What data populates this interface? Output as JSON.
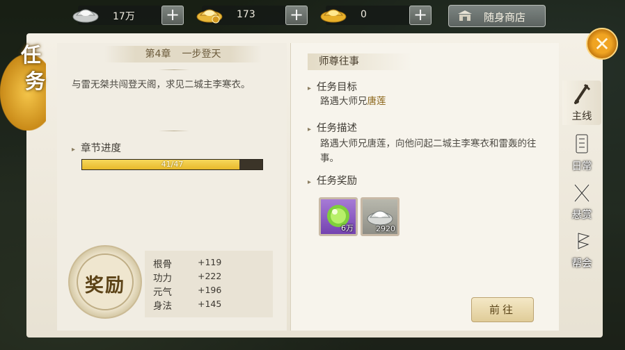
{
  "currency": [
    {
      "name": "silver",
      "value": "17万"
    },
    {
      "name": "gold-ingot",
      "value": "173"
    },
    {
      "name": "bound-gold",
      "value": "0"
    }
  ],
  "shop_label": "随身商店",
  "title": [
    "任",
    "务"
  ],
  "chapter": {
    "number": "第4章",
    "name": "一步登天"
  },
  "quest_description": "与雷无桀共闯登天阁，求见二城主李寒衣。",
  "progress": {
    "label": "章节进度",
    "text": "41/47",
    "current": 41,
    "total": 47
  },
  "reward_seal": "奖励",
  "stats": [
    {
      "name": "根骨",
      "value": "+119"
    },
    {
      "name": "功力",
      "value": "+222"
    },
    {
      "name": "元气",
      "value": "+196"
    },
    {
      "name": "身法",
      "value": "+145"
    }
  ],
  "right": {
    "header": "师尊往事",
    "goal_label": "任务目标",
    "goal_prefix": "路遇大师兄",
    "goal_highlight": "唐莲",
    "desc_label": "任务描述",
    "desc_text": "路遇大师兄唐莲，向他问起二城主李寒衣和雷轰的往事。",
    "reward_label": "任务奖励",
    "rewards": [
      {
        "icon": "experience-orb-icon",
        "count": "6万"
      },
      {
        "icon": "silver-ingot-icon",
        "count": "2920"
      }
    ],
    "goto_label": "前往"
  },
  "tabs": [
    {
      "label": "主线",
      "active": true
    },
    {
      "label": "日常",
      "active": false
    },
    {
      "label": "悬赏",
      "active": false
    },
    {
      "label": "帮会",
      "active": false
    }
  ],
  "colors": {
    "accent_gold": "#e7b92a",
    "highlight_text": "#8a6417",
    "exp_slot": "#7442b0"
  }
}
